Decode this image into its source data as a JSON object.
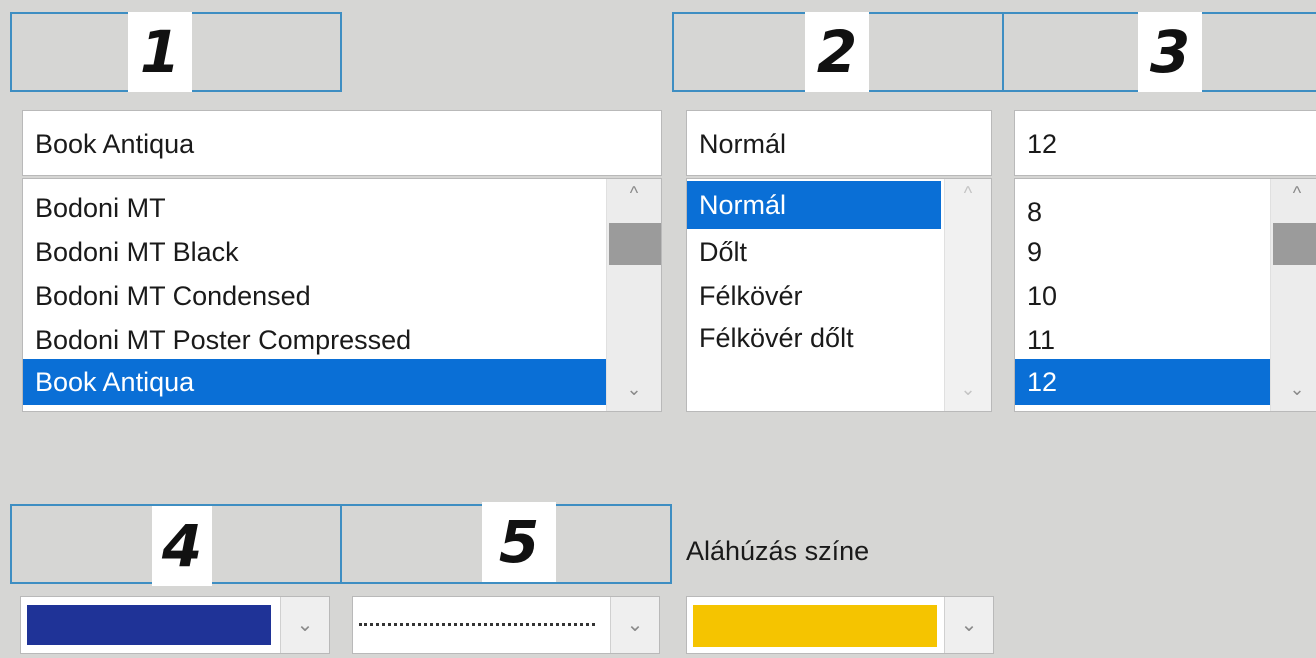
{
  "panels": {
    "font": {
      "number": "1",
      "current_value": "Book Antiqua",
      "items": [
        "Bodoni MT",
        "Bodoni MT Black",
        "Bodoni MT Condensed",
        "Bodoni MT Poster Compressed",
        "Book Antiqua"
      ],
      "selected_index": 4
    },
    "style": {
      "number": "2",
      "current_value": "Normál",
      "items": [
        "Normál",
        "Dőlt",
        "Félkövér",
        "Félkövér dőlt"
      ],
      "selected_index": 0
    },
    "size": {
      "number": "3",
      "current_value": "12",
      "items": [
        "8",
        "9",
        "10",
        "11",
        "12"
      ],
      "selected_index": 4
    }
  },
  "bottom": {
    "color_number": "4",
    "underline_number": "5",
    "underline_color_label": "Aláhúzás színe",
    "font_color": "#1f3397",
    "underline_color": "#f5c400"
  },
  "icons": {
    "scroll_up": "chevron-up-icon",
    "scroll_down": "chevron-down-icon",
    "dropdown": "chevron-down-icon"
  },
  "colors": {
    "selection": "#0a6fd6",
    "label_border": "#3e8ec2",
    "background": "#d6d6d4"
  }
}
